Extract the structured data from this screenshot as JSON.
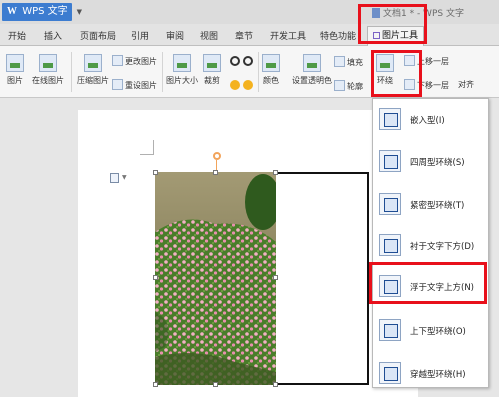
{
  "titlebar": {
    "app_logo": "W",
    "app_name": "WPS 文字",
    "doc_title": "文档1 * - WPS 文字"
  },
  "tabs": [
    "开始",
    "插入",
    "页面布局",
    "引用",
    "审阅",
    "视图",
    "章节",
    "开发工具",
    "特色功能",
    "图片工具"
  ],
  "ribbon": {
    "picture": "图片",
    "online_picture": "在线图片",
    "compress": "压缩图片",
    "change_picture": "更改图片",
    "reset_picture": "重设图片",
    "picture_size": "图片大小",
    "crop": "裁剪",
    "color": "颜色",
    "set_transparent": "设置透明色",
    "fill": "填充",
    "outline": "轮廓",
    "wrap": "环绕",
    "bring_forward": "上移一层",
    "send_backward": "下移一层",
    "align": "对齐"
  },
  "wrap_menu": {
    "items": [
      "嵌入型(I)",
      "四周型环绕(S)",
      "紧密型环绕(T)",
      "衬于文字下方(D)",
      "浮于文字上方(N)",
      "上下型环绕(O)",
      "穿越型环绕(H)"
    ],
    "highlighted_index": 4
  },
  "colors": {
    "highlight": "#e8101b",
    "app_blue": "#3c7cd0"
  }
}
